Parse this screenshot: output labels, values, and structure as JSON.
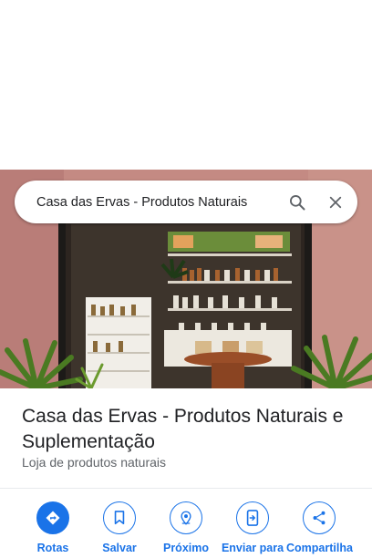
{
  "search": {
    "query": "Casa das Ervas - Produtos Naturais"
  },
  "place": {
    "name": "Casa das Ervas - Produtos Naturais e Suplementação",
    "category": "Loja de produtos naturais"
  },
  "actions": [
    {
      "label": "Rotas",
      "icon": "directions-icon"
    },
    {
      "label": "Salvar",
      "icon": "bookmark-icon"
    },
    {
      "label": "Próximo",
      "icon": "nearby-icon"
    },
    {
      "label": "Enviar para",
      "icon": "send-to-phone-icon"
    },
    {
      "label": "Compartilha",
      "icon": "share-icon"
    }
  ],
  "colors": {
    "accent": "#1a73e8",
    "title": "#202124",
    "secondary": "#5f6368"
  }
}
